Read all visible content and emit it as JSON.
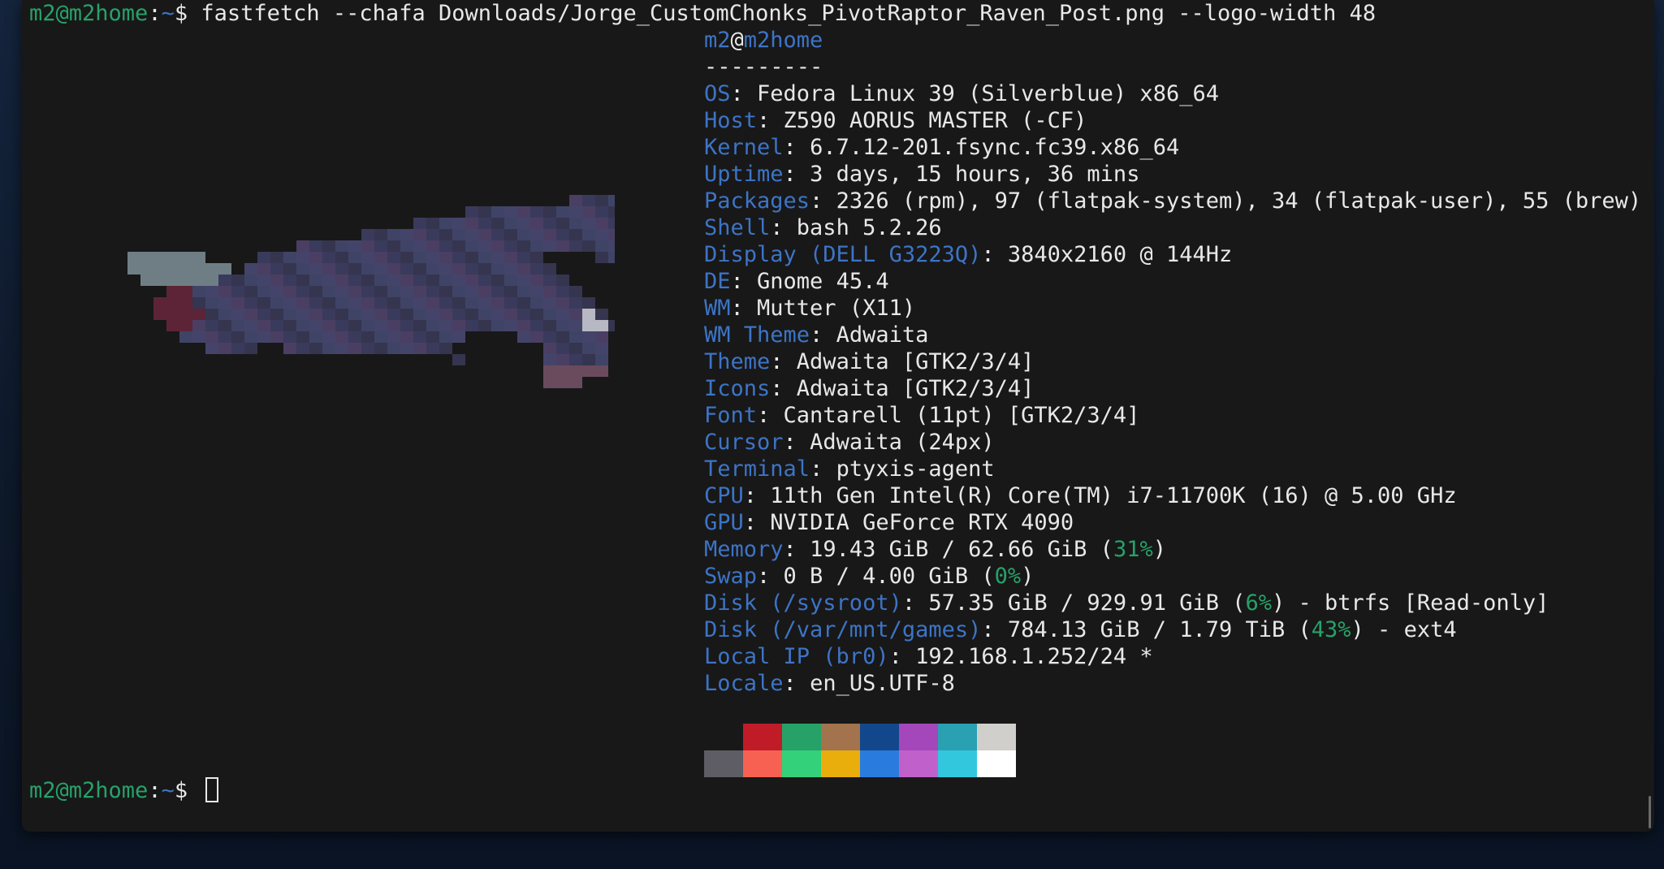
{
  "command_line": {
    "user": "m2@m2home",
    "sep": ":",
    "cwd": "~",
    "dollar": "$ ",
    "command": "fastfetch --chafa Downloads/Jorge_CustomChonks_PivotRaptor_Raven_Post.png --logo-width 48"
  },
  "header": {
    "user": "m2",
    "at": "@",
    "host": "m2home",
    "separator": "---------"
  },
  "info": [
    {
      "key": "OS",
      "sep": ": ",
      "value": "Fedora Linux 39 (Silverblue) x86_64"
    },
    {
      "key": "Host",
      "sep": ": ",
      "value": "Z590 AORUS MASTER (-CF)"
    },
    {
      "key": "Kernel",
      "sep": ": ",
      "value": "6.7.12-201.fsync.fc39.x86_64"
    },
    {
      "key": "Uptime",
      "sep": ": ",
      "value": "3 days, 15 hours, 36 mins"
    },
    {
      "key": "Packages",
      "sep": ": ",
      "value": "2326 (rpm), 97 (flatpak-system), 34 (flatpak-user), 55 (brew)"
    },
    {
      "key": "Shell",
      "sep": ": ",
      "value": "bash 5.2.26"
    },
    {
      "key": "Display (DELL G3223Q)",
      "sep": ": ",
      "value": "3840x2160 @ 144Hz"
    },
    {
      "key": "DE",
      "sep": ": ",
      "value": "Gnome 45.4"
    },
    {
      "key": "WM",
      "sep": ": ",
      "value": "Mutter (X11)"
    },
    {
      "key": "WM Theme",
      "sep": ": ",
      "value": "Adwaita"
    },
    {
      "key": "Theme",
      "sep": ": ",
      "value": "Adwaita [GTK2/3/4]"
    },
    {
      "key": "Icons",
      "sep": ": ",
      "value": "Adwaita [GTK2/3/4]"
    },
    {
      "key": "Font",
      "sep": ": ",
      "value": "Cantarell (11pt) [GTK2/3/4]"
    },
    {
      "key": "Cursor",
      "sep": ": ",
      "value": "Adwaita (24px)"
    },
    {
      "key": "Terminal",
      "sep": ": ",
      "value": "ptyxis-agent"
    },
    {
      "key": "CPU",
      "sep": ": ",
      "value": "11th Gen Intel(R) Core(TM) i7-11700K (16) @ 5.00 GHz"
    },
    {
      "key": "GPU",
      "sep": ": ",
      "value": "NVIDIA GeForce RTX 4090"
    }
  ],
  "info_pct": [
    {
      "key": "Memory",
      "sep": ": ",
      "pre": "19.43 GiB / 62.66 GiB (",
      "pct": "31%",
      "post": ")"
    },
    {
      "key": "Swap",
      "sep": ": ",
      "pre": "0 B / 4.00 GiB (",
      "pct": "0%",
      "post": ")"
    },
    {
      "key": "Disk (/sysroot)",
      "sep": ": ",
      "pre": "57.35 GiB / 929.91 GiB (",
      "pct": "6%",
      "post": ") - btrfs [Read-only]"
    },
    {
      "key": "Disk (/var/mnt/games)",
      "sep": ": ",
      "pre": "784.13 GiB / 1.79 TiB (",
      "pct": "43%",
      "post": ") - ext4"
    }
  ],
  "info_tail": [
    {
      "key": "Local IP (br0)",
      "sep": ": ",
      "value": "192.168.1.252/24 *"
    },
    {
      "key": "Locale",
      "sep": ": ",
      "value": "en_US.UTF-8"
    }
  ],
  "palette": {
    "row1": [
      "#181818",
      "#c01c28",
      "#26a269",
      "#a2734c",
      "#12488b",
      "#a347ba",
      "#2aa1b3",
      "#d0cfcc"
    ],
    "row2": [
      "#5e5c64",
      "#f66151",
      "#33d17a",
      "#e9ad0c",
      "#2a7bde",
      "#c061cb",
      "#33c7de",
      "#ffffff"
    ]
  },
  "prompt": {
    "user": "m2@m2home",
    "sep": ":",
    "cwd": "~",
    "dollar": "$ "
  },
  "colors": {
    "prompt_green": "#26a269",
    "key_blue": "#3d74c6",
    "text": "#e8e8e8",
    "background": "#181818"
  }
}
